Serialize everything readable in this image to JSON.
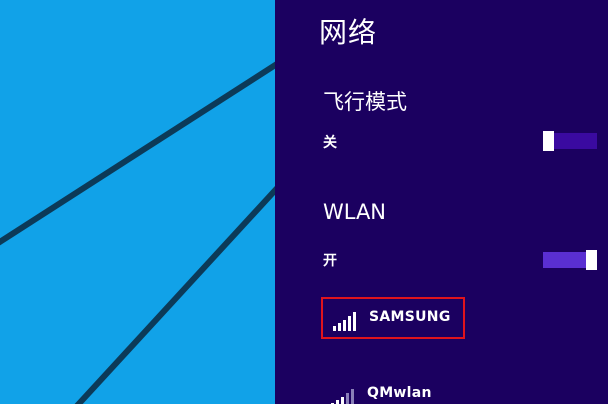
{
  "panel": {
    "title": "网络",
    "background": "#1b0060"
  },
  "airplane_mode": {
    "label": "飞行模式",
    "state": "关",
    "on": false
  },
  "wlan": {
    "label": "WLAN",
    "state": "开",
    "on": true
  },
  "networks": [
    {
      "ssid": "SAMSUNG",
      "highlighted": true,
      "highlight_color": "#e0141c",
      "icon": "wifi-signal-icon"
    },
    {
      "ssid": "QMwlan",
      "highlighted": false,
      "icon": "wifi-signal-icon"
    }
  ],
  "wallpaper": {
    "color": "#11a2e8"
  }
}
